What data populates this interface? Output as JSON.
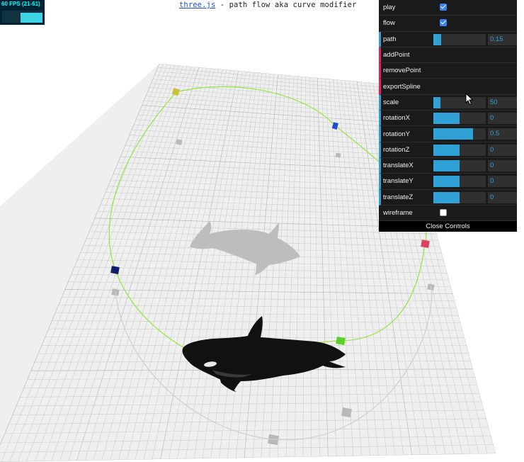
{
  "stats": {
    "fps_text": "60 FPS (21-61)"
  },
  "info": {
    "link_text": "three.js",
    "description": " - path flow aka curve modifier"
  },
  "gui": {
    "play": {
      "label": "play",
      "checked": true
    },
    "flow": {
      "label": "flow",
      "checked": true
    },
    "path": {
      "label": "path",
      "value": "0.15",
      "fraction": 0.15
    },
    "addPoint": {
      "label": "addPoint"
    },
    "removePoint": {
      "label": "removePoint"
    },
    "exportSpline": {
      "label": "exportSpline"
    },
    "scale": {
      "label": "scale",
      "value": "50",
      "fraction": 0.13
    },
    "rotationX": {
      "label": "rotationX",
      "value": "0",
      "fraction": 0.5
    },
    "rotationY": {
      "label": "rotationY",
      "value": "0.5",
      "fraction": 0.75
    },
    "rotationZ": {
      "label": "rotationZ",
      "value": "0",
      "fraction": 0.5
    },
    "translateX": {
      "label": "translateX",
      "value": "0",
      "fraction": 0.5
    },
    "translateY": {
      "label": "translateY",
      "value": "0",
      "fraction": 0.5
    },
    "translateZ": {
      "label": "translateZ",
      "value": "0",
      "fraction": 0.5
    },
    "wireframe": {
      "label": "wireframe",
      "checked": false
    },
    "close_label": "Close Controls"
  },
  "colors": {
    "gui_bg": "#1a1a1a",
    "number_accent": "#2fa1d6",
    "function_accent": "#e61d5f",
    "curve": "#99e64d",
    "grid_line": "#c8c8c8",
    "whale": "#111111"
  },
  "scene": {
    "control_points": [
      {
        "name": "yellow-point",
        "color": "#c9c23a"
      },
      {
        "name": "blue-point-top",
        "color": "#1f4fd0"
      },
      {
        "name": "pink-point",
        "color": "#e04060"
      },
      {
        "name": "green-point",
        "color": "#5cd02a"
      },
      {
        "name": "navy-point",
        "color": "#101d6a"
      }
    ]
  }
}
